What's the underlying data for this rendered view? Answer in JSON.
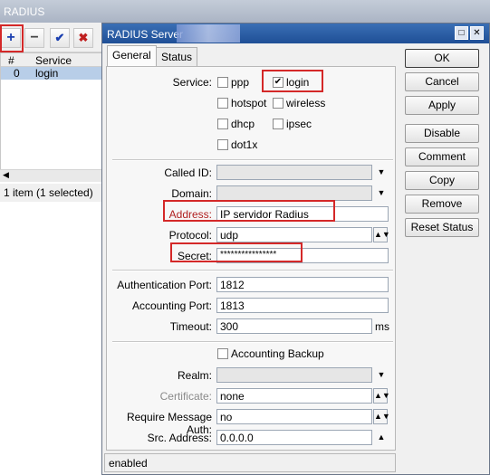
{
  "background_window": {
    "title": "RADIUS",
    "toolbar": {
      "add": "+",
      "remove": "−",
      "enable": "✔",
      "disable": "✖"
    },
    "columns": [
      "#",
      "Service"
    ],
    "rows": [
      {
        "num": "0",
        "service": "login"
      }
    ],
    "status": "1 item (1 selected)"
  },
  "dialog": {
    "title": "RADIUS Server",
    "tabs": [
      "General",
      "Status"
    ],
    "service": {
      "label": "Service:",
      "options": [
        {
          "name": "ppp",
          "checked": false
        },
        {
          "name": "login",
          "checked": true
        },
        {
          "name": "hotspot",
          "checked": false
        },
        {
          "name": "wireless",
          "checked": false
        },
        {
          "name": "dhcp",
          "checked": false
        },
        {
          "name": "ipsec",
          "checked": false
        },
        {
          "name": "dot1x",
          "checked": false
        }
      ]
    },
    "called_id": {
      "label": "Called ID:",
      "value": ""
    },
    "domain": {
      "label": "Domain:",
      "value": ""
    },
    "address": {
      "label": "Address:",
      "value": "IP servidor Radius"
    },
    "protocol": {
      "label": "Protocol:",
      "value": "udp"
    },
    "secret": {
      "label": "Secret:",
      "value": "****************"
    },
    "auth_port": {
      "label": "Authentication Port:",
      "value": "1812"
    },
    "acct_port": {
      "label": "Accounting Port:",
      "value": "1813"
    },
    "timeout": {
      "label": "Timeout:",
      "value": "300",
      "unit": "ms"
    },
    "accounting_backup": {
      "label": "Accounting Backup",
      "checked": false
    },
    "realm": {
      "label": "Realm:",
      "value": ""
    },
    "certificate": {
      "label": "Certificate:",
      "value": "none"
    },
    "require_message_auth": {
      "label": "Require Message Auth:",
      "value": "no"
    },
    "src_address": {
      "label": "Src. Address:",
      "value": "0.0.0.0"
    },
    "buttons": [
      "OK",
      "Cancel",
      "Apply",
      "Disable",
      "Comment",
      "Copy",
      "Remove",
      "Reset Status"
    ],
    "status": "enabled",
    "colors": {
      "highlight": "#d42828",
      "titlebar": "#1f4f96",
      "selection": "#b8cee8"
    },
    "icons": {
      "dropdown": "▼",
      "stepper": "▲▼",
      "collapse": "▲",
      "check": "✔"
    }
  }
}
